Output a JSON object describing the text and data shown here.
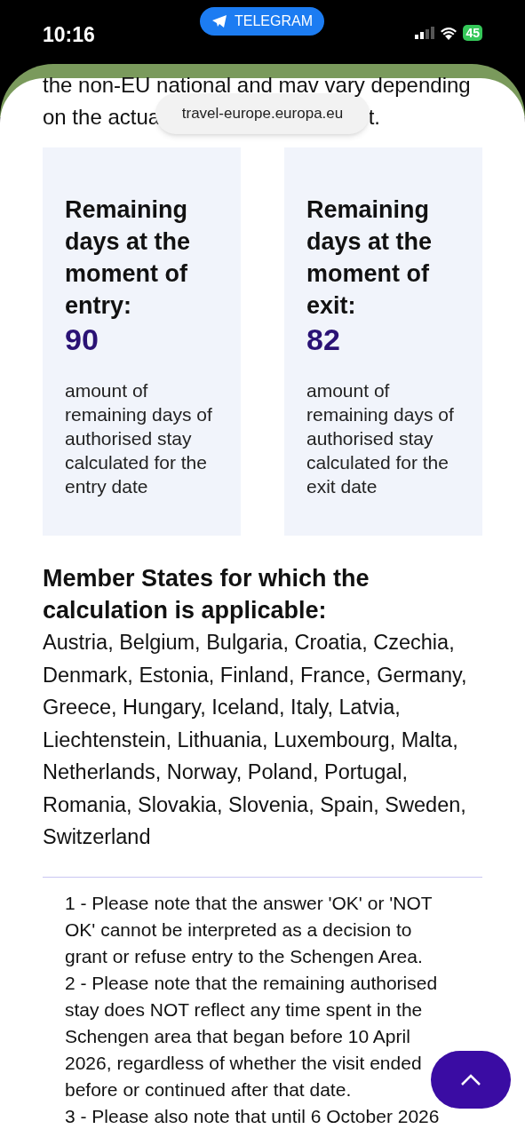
{
  "status_bar": {
    "time": "10:16",
    "app_pill": "TELEGRAM",
    "battery": "45"
  },
  "browser": {
    "url": "travel-europe.europa.eu"
  },
  "intro": {
    "line_1": "the non-EU national and mav vary depending",
    "line_2_left": "on the actua",
    "line_2_right": "t."
  },
  "cards": [
    {
      "title": "Remaining days at the moment of entry:",
      "value": "90",
      "description": "amount of remaining days of authorised stay calculated for the entry date"
    },
    {
      "title": "Remaining days at the moment of exit:",
      "value": "82",
      "description": "amount of remaining days of authorised stay calculated for the exit date"
    }
  ],
  "member_states": {
    "heading": "Member States for which the calculation is applicable:",
    "list": "Austria, Belgium, Bulgaria, Croatia, Czechia, Denmark, Estonia, Finland, France, Germany, Greece, Hungary, Iceland, Italy, Latvia, Liechtenstein, Lithuania, Luxembourg, Malta, Netherlands, Norway, Poland, Portugal, Romania, Slovakia, Slovenia, Spain, Sweden, Switzerland"
  },
  "notes": [
    "1 - Please note that the answer 'OK' or 'NOT OK' cannot be interpreted as a decision to grant or refuse entry to the Schengen Area.",
    "2 - Please note that the remaining authorised stay does NOT reflect any time spent in the Schengen area that began before 10 April 2026, regardless of whether the visit ended before or continued after that date.",
    "3 - Please also note that until 6 October 2026"
  ]
}
